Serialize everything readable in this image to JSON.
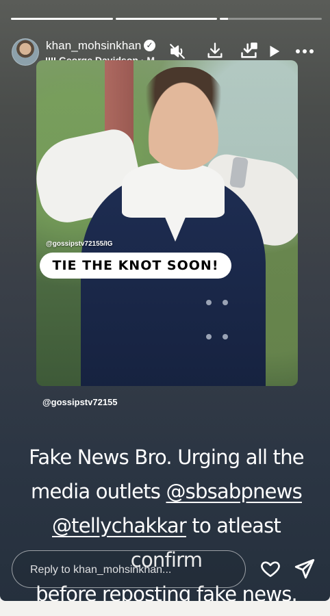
{
  "story": {
    "progress": [
      1.0,
      1.0,
      0.08
    ],
    "username": "khan_mohsinkhan",
    "music_label": "George Davidson · M",
    "icons": [
      "verified-badge-icon",
      "mute-icon",
      "download-icon",
      "save-icon",
      "play-icon",
      "more-icon"
    ]
  },
  "post": {
    "watermark": "@gossipstv72155/IG",
    "headline": "TIE THE KNOT SOON!"
  },
  "credit": "@gossipstv72155",
  "caption": {
    "line1": "Fake News Bro. Urging all the",
    "line2_prefix": "media outlets ",
    "mention1": "@sbsabpnews",
    "mention2": "@tellychakkar",
    "line3_suffix": " to atleast confirm",
    "line4": "before reposting fake news."
  },
  "reply": {
    "placeholder": "Reply to khan_mohsinkhan..."
  }
}
